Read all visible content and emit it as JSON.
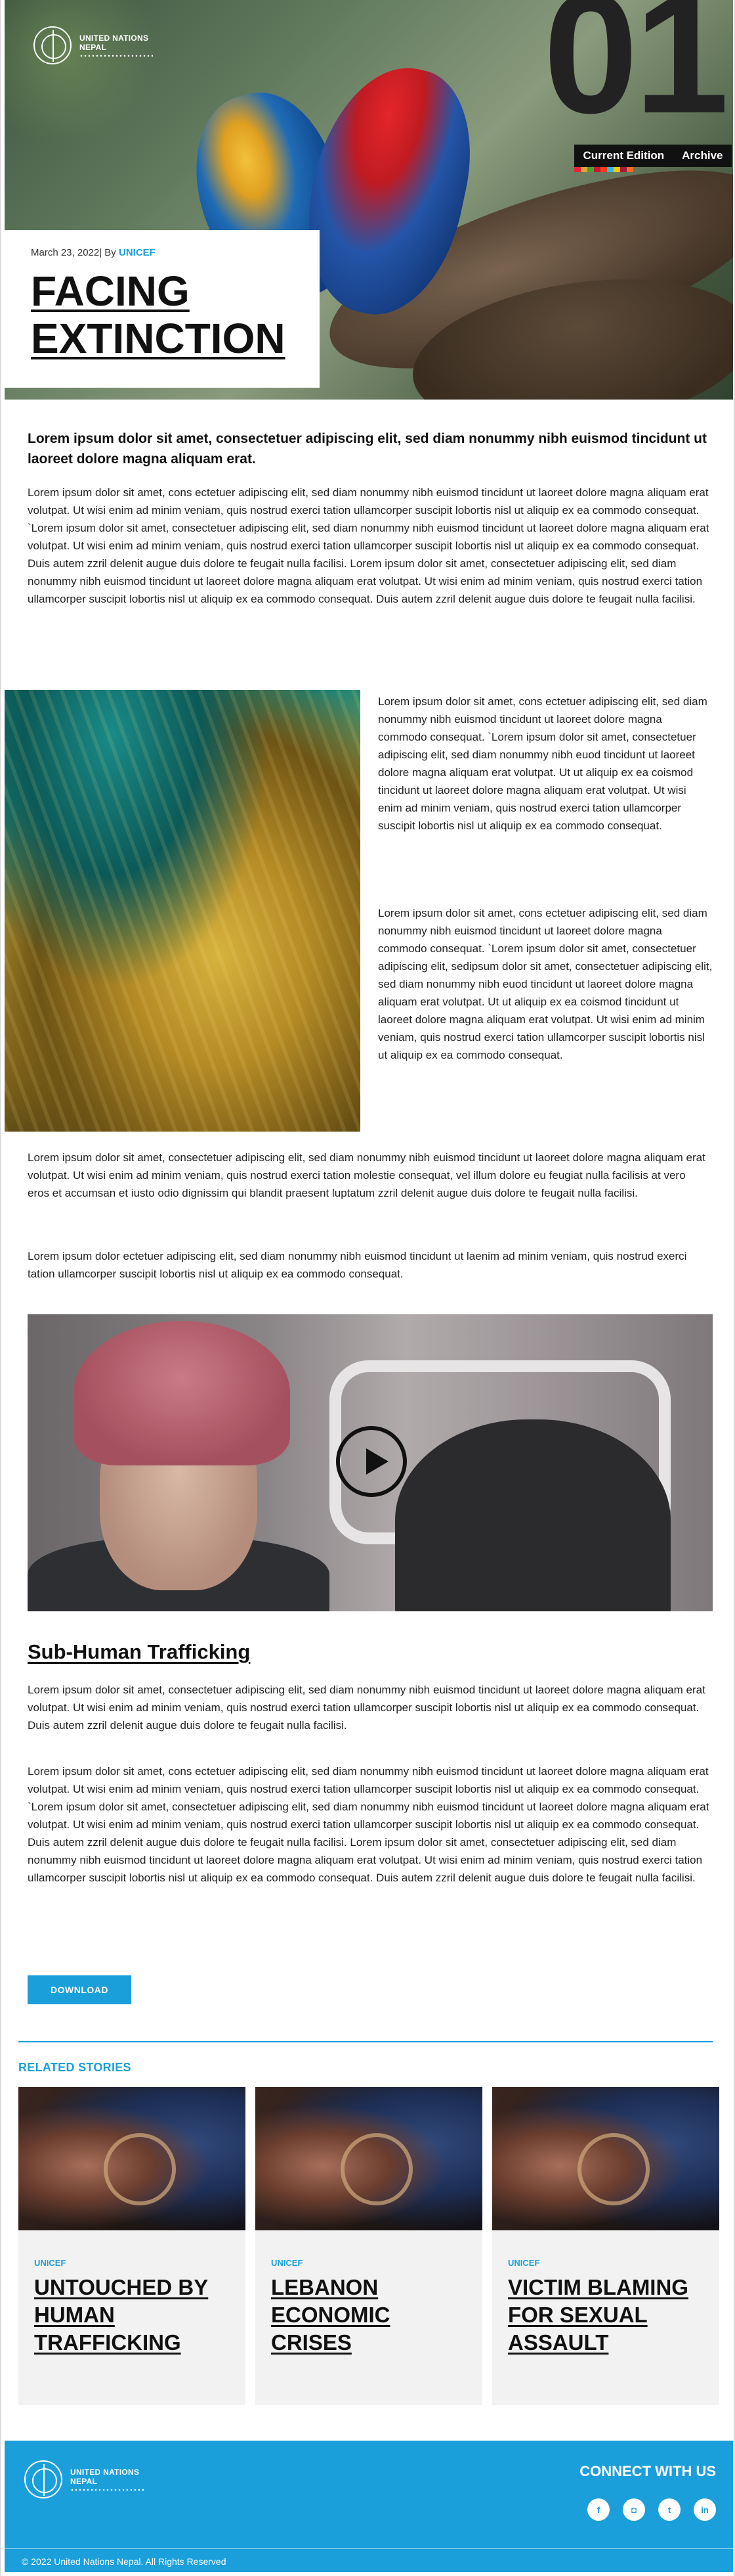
{
  "brand": {
    "org_line1": "UNITED NATIONS",
    "org_line2": "NEPAL"
  },
  "hero": {
    "issue_number": "01",
    "nav": [
      "Current Edition",
      "Archive"
    ],
    "date": "March 23, 2022",
    "byline_prefix": "| By ",
    "author": "UNICEF",
    "headline": "FACING EXTINCTION",
    "sdg_colors": [
      "#e5243b",
      "#dda63a",
      "#4c9f38",
      "#c5192d",
      "#ff3a21",
      "#26bde2",
      "#fcc30b",
      "#a21942",
      "#fd6925"
    ]
  },
  "article": {
    "lead": "Lorem ipsum dolor sit amet, consectetuer adipiscing elit, sed diam nonummy nibh euismod tincidunt ut laoreet dolore magna aliquam erat.",
    "para1": "Lorem ipsum dolor sit amet, cons ectetuer adipiscing elit, sed diam nonummy nibh euismod tincidunt ut laoreet dolore magna aliquam erat volutpat. Ut wisi enim ad minim veniam, quis nostrud exerci tation ullamcorper suscipit lobortis nisl ut aliquip ex ea commodo consequat. `Lorem ipsum dolor sit amet, consectetuer adipiscing elit, sed diam nonummy nibh euismod tincidunt ut laoreet dolore magna aliquam erat volutpat. Ut wisi enim ad minim veniam, quis nostrud exerci tation ullamcorper suscipit lobortis nisl ut aliquip ex ea commodo consequat. Duis autem zzril delenit augue duis dolore te feugait nulla facilisi. Lorem ipsum dolor sit amet, consectetuer adipiscing elit, sed diam nonummy nibh euismod tincidunt ut laoreet dolore magna aliquam erat volutpat. Ut wisi enim ad minim veniam, quis nostrud exerci tation ullamcorper suscipit lobortis nisl ut aliquip ex ea commodo consequat. Duis autem zzril delenit augue duis dolore te feugait nulla facilisi.",
    "side1": "Lorem ipsum dolor sit amet, cons ectetuer adipiscing elit, sed diam nonummy nibh euismod tincidunt ut laoreet dolore magna commodo consequat. `Lorem ipsum dolor sit amet, consectetuer adipiscing elit, sed diam nonummy nibh euod tincidunt ut laoreet dolore magna aliquam erat volutpat. Ut  ut aliquip ex ea coismod tincidunt ut laoreet dolore magna aliquam erat volutpat. Ut wisi enim ad minim veniam, quis nostrud exerci tation ullamcorper suscipit lobortis nisl ut aliquip ex ea commodo consequat.",
    "side2": "Lorem ipsum dolor sit amet, cons ectetuer adipiscing elit, sed diam nonummy nibh euismod tincidunt ut laoreet dolore magna commodo consequat. `Lorem ipsum dolor sit amet, consectetuer adipiscing elit, sedipsum dolor sit amet, consectetuer adipiscing elit, sed diam nonummy nibh euod tincidunt ut laoreet dolore magna aliquam erat volutpat. Ut  ut aliquip ex ea coismod tincidunt ut laoreet dolore magna aliquam erat volutpat. Ut wisi enim ad minim veniam, quis nostrud exerci tation ullamcorper suscipit lobortis nisl ut aliquip ex ea commodo consequat.",
    "para2": "Lorem ipsum dolor sit amet, consectetuer adipiscing elit, sed diam nonummy nibh euismod tincidunt ut laoreet dolore magna aliquam erat volutpat. Ut wisi enim ad minim veniam, quis nostrud exerci tation  molestie consequat, vel illum dolore eu feugiat nulla facilisis at vero eros et accumsan et iusto odio dignissim qui blandit praesent luptatum zzril delenit augue duis dolore te feugait nulla facilisi.",
    "para3": "Lorem ipsum dolor ectetuer adipiscing elit, sed diam nonummy nibh euismod tincidunt ut laenim ad minim veniam, quis nostrud exerci tation ullamcorper suscipit lobortis nisl ut aliquip ex ea commodo consequat.",
    "section_title": "Sub-Human Trafficking",
    "para4": "Lorem ipsum dolor sit amet, consectetuer adipiscing elit, sed diam nonummy nibh euismod tincidunt ut laoreet dolore magna aliquam erat volutpat. Ut wisi enim ad minim veniam, quis nostrud exerci tation ullamcorper suscipit lobortis nisl ut aliquip ex ea commodo consequat. Duis autem zzril delenit augue duis dolore te feugait nulla facilisi.",
    "para5": "Lorem ipsum dolor sit amet, cons ectetuer adipiscing elit, sed diam nonummy nibh euismod tincidunt ut laoreet dolore magna aliquam erat volutpat. Ut wisi enim ad minim veniam, quis nostrud exerci tation ullamcorper suscipit lobortis nisl ut aliquip ex ea commodo consequat. `Lorem ipsum dolor sit amet, consectetuer adipiscing elit, sed diam nonummy nibh euismod tincidunt ut laoreet dolore magna aliquam erat volutpat. Ut wisi enim ad minim veniam, quis nostrud exerci tation ullamcorper suscipit lobortis nisl ut aliquip ex ea commodo consequat. Duis autem zzril delenit augue duis dolore te feugait nulla facilisi. Lorem ipsum dolor sit amet, consectetuer adipiscing elit, sed diam nonummy nibh euismod tincidunt ut laoreet dolore magna aliquam erat volutpat. Ut wisi enim ad minim veniam, quis nostrud exerci tation ullamcorper suscipit lobortis nisl ut aliquip ex ea commodo consequat. Duis autem zzril delenit augue duis dolore te feugait nulla facilisi.",
    "download_label": "DOWNLOAD"
  },
  "related": {
    "label": "RELATED STORIES",
    "stories": [
      {
        "tag": "UNICEF",
        "title": "UNTOUCHED BY HUMAN TRAFFICKING"
      },
      {
        "tag": "UNICEF",
        "title": "LEBANON ECONOMIC CRISES"
      },
      {
        "tag": "UNICEF",
        "title": "VICTIM BLAMING FOR SEXUAL ASSAULT"
      }
    ]
  },
  "footer": {
    "connect": "CONNECT WITH US",
    "social_icons": [
      "facebook-icon",
      "instagram-icon",
      "twitter-icon",
      "linkedin-icon"
    ],
    "social_glyphs": [
      "f",
      "◘",
      "t",
      "in"
    ],
    "copyright": "© 2022 United Nations Nepal. All Rights Reserved"
  },
  "colors": {
    "accent": "#1a9fdb",
    "headline": "#111111"
  }
}
